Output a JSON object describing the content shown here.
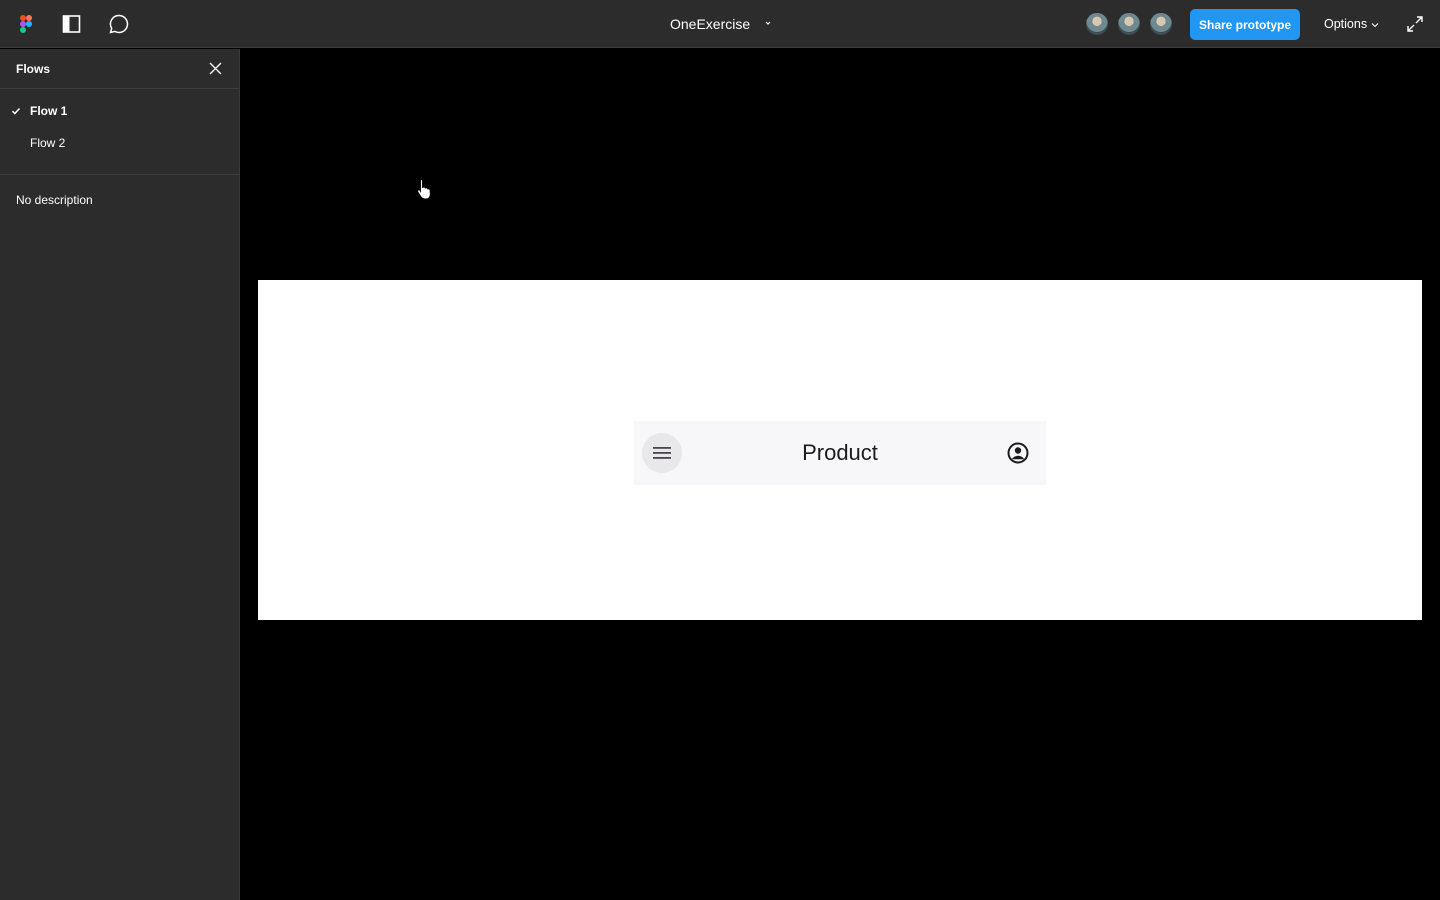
{
  "topbar": {
    "file_title": "OneExercise",
    "share_label": "Share prototype",
    "options_label": "Options",
    "accent_color": "#2196f3",
    "icons": [
      "figma-logo-icon",
      "sidebar-toggle-icon",
      "comment-icon",
      "chevron-down-icon",
      "fullscreen-icon"
    ]
  },
  "sidebar": {
    "title": "Flows",
    "flows": [
      {
        "label": "Flow 1",
        "selected": true
      },
      {
        "label": "Flow 2",
        "selected": false
      }
    ],
    "description": "No description"
  },
  "prototype": {
    "appbar_title": "Product",
    "icons": [
      "menu-icon",
      "account-circle-icon"
    ]
  }
}
